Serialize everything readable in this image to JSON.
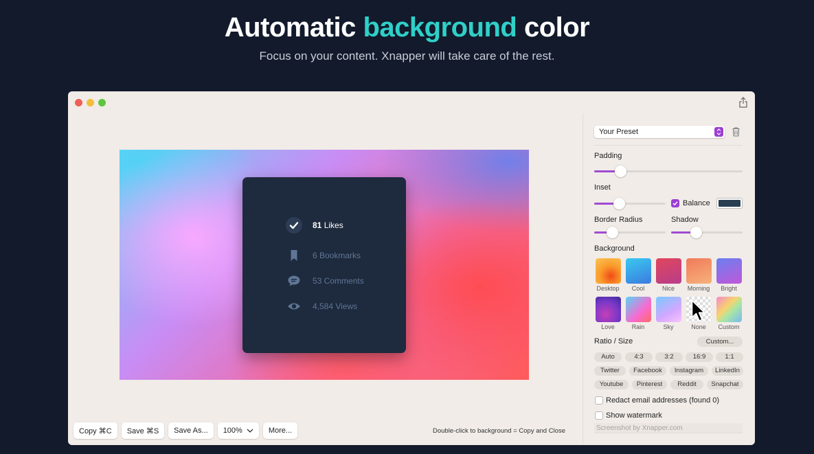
{
  "hero": {
    "title_pre": "Automatic ",
    "title_accent": "background",
    "title_post": " color",
    "subtitle": "Focus on your content. Xnapper will take care of the rest.",
    "accent_color": "#2fd0c8"
  },
  "card": {
    "likes_count": "81",
    "likes_label": " Likes",
    "bookmarks": "6 Bookmarks",
    "comments": "53 Comments",
    "views": "4,584 Views"
  },
  "toolbar": {
    "copy": "Copy ⌘C",
    "save": "Save ⌘S",
    "save_as": "Save As...",
    "zoom": "100%",
    "more": "More...",
    "hint": "Double-click to background = Copy and Close"
  },
  "sidebar": {
    "preset": "Your Preset",
    "padding_label": "Padding",
    "padding_value": 0.18,
    "inset_label": "Inset",
    "inset_value": 0.35,
    "balance_label": "Balance",
    "balance_checked": true,
    "balance_color": "#2a3e52",
    "border_radius_label": "Border Radius",
    "border_radius_value": 0.25,
    "shadow_label": "Shadow",
    "shadow_value": 0.35,
    "background_label": "Background",
    "backgrounds": [
      "Desktop",
      "Cool",
      "Nice",
      "Morning",
      "Bright",
      "Love",
      "Rain",
      "Sky",
      "None",
      "Custom"
    ],
    "ratio_label": "Ratio / Size",
    "custom_button": "Custom...",
    "ratios": [
      "Auto",
      "4:3",
      "3:2",
      "16:9",
      "1:1"
    ],
    "sizes_row1": [
      "Twitter",
      "Facebook",
      "Instagram",
      "LinkedIn"
    ],
    "sizes_row2": [
      "Youtube",
      "Pinterest",
      "Reddit",
      "Snapchat"
    ],
    "redact_label": "Redact email addresses (found 0)",
    "watermark_label": "Show watermark",
    "watermark_placeholder": "Screenshot by Xnapper.com"
  }
}
